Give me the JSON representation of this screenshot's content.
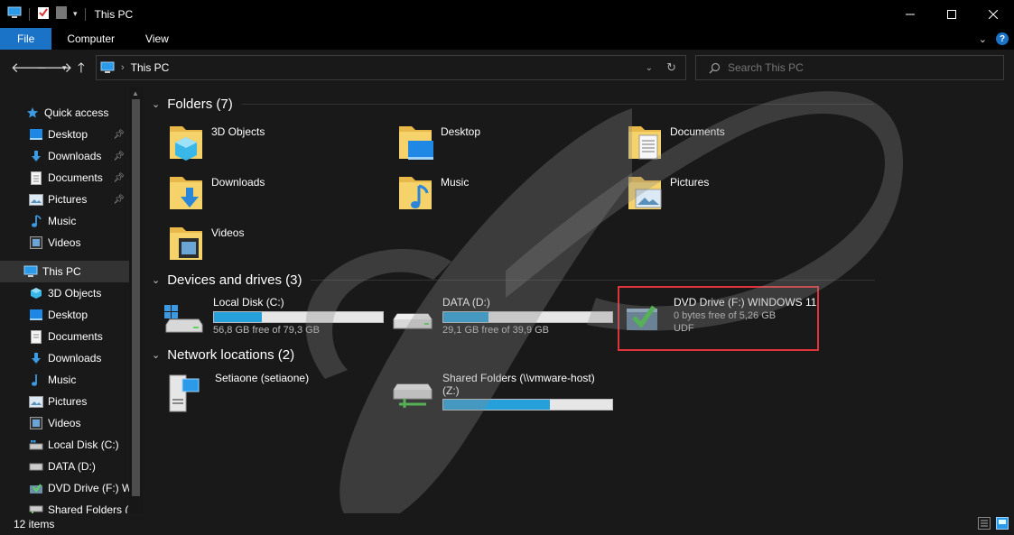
{
  "window": {
    "title": "This PC"
  },
  "ribbon": {
    "tabs": [
      "File",
      "Computer",
      "View"
    ]
  },
  "address": {
    "location": "This PC"
  },
  "search": {
    "placeholder": "Search This PC"
  },
  "nav": {
    "quick_access": "Quick access",
    "quick_items": [
      "Desktop",
      "Downloads",
      "Documents",
      "Pictures",
      "Music",
      "Videos"
    ],
    "this_pc": "This PC",
    "pc_items": [
      "3D Objects",
      "Desktop",
      "Documents",
      "Downloads",
      "Music",
      "Pictures",
      "Videos",
      "Local Disk (C:)",
      "DATA (D:)",
      "DVD Drive (F:) W",
      "Shared Folders ("
    ]
  },
  "folders": {
    "header": "Folders (7)",
    "items": [
      "3D Objects",
      "Desktop",
      "Documents",
      "Downloads",
      "Music",
      "Pictures",
      "Videos"
    ]
  },
  "drives": {
    "header": "Devices and drives (3)",
    "items": [
      {
        "name": "Local Disk (C:)",
        "free": "56,8 GB free of 79,3 GB",
        "used_fraction": 0.284
      },
      {
        "name": "DATA (D:)",
        "free": "29,1 GB free of 39,9 GB",
        "used_fraction": 0.27
      },
      {
        "name": "DVD Drive (F:) WINDOWS 11",
        "free": "0 bytes free of 5,26 GB",
        "fs": "UDF"
      }
    ]
  },
  "network": {
    "header": "Network locations (2)",
    "items": [
      {
        "name": "Setiaone (setiaone)"
      },
      {
        "name": "Shared Folders (\\\\vmware-host)",
        "name2": "(Z:)",
        "used_fraction": 0.63
      }
    ]
  },
  "status": {
    "count": "12 items"
  },
  "colors": {
    "accent": "#1a73c7",
    "bar_fill": "#26a0da",
    "highlight": "#e0343b"
  }
}
